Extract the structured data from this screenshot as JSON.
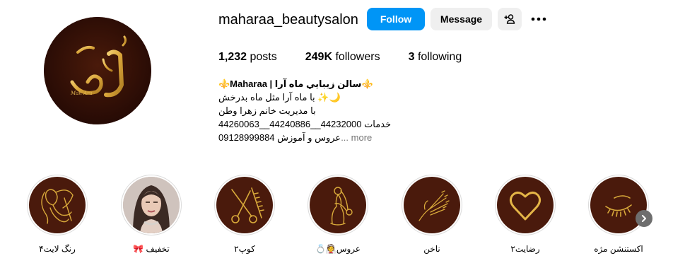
{
  "profile": {
    "username": "maharaa_beautysalon",
    "follow_label": "Follow",
    "message_label": "Message",
    "posts_count": "1,232",
    "posts_label": "posts",
    "followers_count": "249K",
    "followers_label": "followers",
    "following_count": "3",
    "following_label": "following",
    "avatar_text": "ماه آرا",
    "avatar_sub": "Mah Ara"
  },
  "bio": {
    "line1": "⚜️Maharaa | سالن زيبايي ماه آرا⚜️",
    "line2": "با ماه آرا مثل ماه بدرخش ✨🌙",
    "line3": "با مدیریت خانم زهرا وطن",
    "line4": "44260063__44240886__44232000 خدمات",
    "line5": "09128999884 عروس و آموزش",
    "more_label": "... more"
  },
  "highlights": [
    {
      "label": "رنگ لایت۴",
      "icon": "woman-hair-icon"
    },
    {
      "label": "تخفیف 🎀",
      "icon": "avatar-photo"
    },
    {
      "label": "کوپ۲",
      "icon": "scissors-comb-icon"
    },
    {
      "label": "عروس👰💍",
      "icon": "bride-icon"
    },
    {
      "label": "ناخن",
      "icon": "nail-hand-icon"
    },
    {
      "label": "رضایت۲",
      "icon": "heart-icon"
    },
    {
      "label": "اکستنشن مژه",
      "icon": "eyelash-icon"
    }
  ],
  "colors": {
    "accent": "#0095f6",
    "highlight_bg": "#4a1a0c",
    "gold": "#d8a93a"
  }
}
